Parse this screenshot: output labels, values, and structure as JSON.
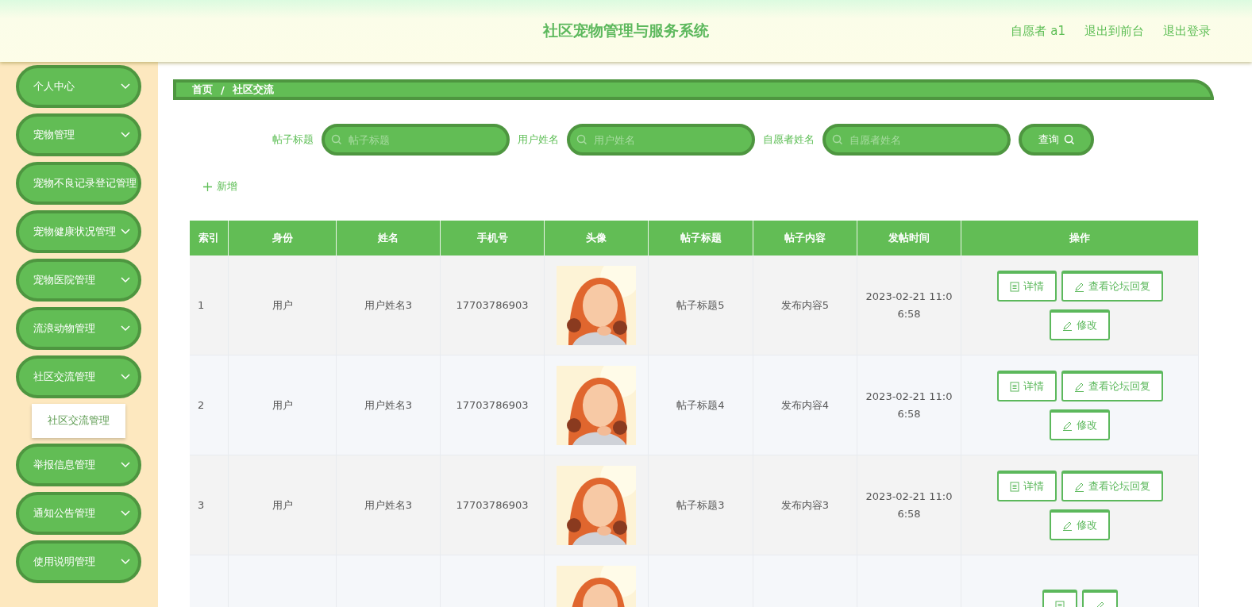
{
  "header": {
    "title": "社区宠物管理与服务系统",
    "links": [
      "自愿者 a1",
      "退出到前台",
      "退出登录"
    ]
  },
  "sidebar": {
    "items": [
      {
        "label": "个人中心",
        "has_caret": true
      },
      {
        "label": "宠物管理",
        "has_caret": true
      },
      {
        "label": "宠物不良记录登记管理",
        "has_caret": false
      },
      {
        "label": "宠物健康状况管理",
        "has_caret": true
      },
      {
        "label": "宠物医院管理",
        "has_caret": true
      },
      {
        "label": "流浪动物管理",
        "has_caret": true
      },
      {
        "label": "社区交流管理",
        "has_caret": true,
        "children": [
          {
            "label": "社区交流管理"
          }
        ]
      },
      {
        "label": "举报信息管理",
        "has_caret": true
      },
      {
        "label": "通知公告管理",
        "has_caret": true
      },
      {
        "label": "使用说明管理",
        "has_caret": true
      }
    ]
  },
  "breadcrumb": [
    "首页",
    "社区交流"
  ],
  "breadcrumb_separator": "/",
  "search": {
    "fields": [
      {
        "label": "帖子标题",
        "placeholder": "帖子标题"
      },
      {
        "label": "用户姓名",
        "placeholder": "用户姓名"
      },
      {
        "label": "自愿者姓名",
        "placeholder": "自愿者姓名"
      }
    ],
    "button": "查询"
  },
  "add_button": "新增",
  "table": {
    "columns": [
      "索引",
      "身份",
      "姓名",
      "手机号",
      "头像",
      "帖子标题",
      "帖子内容",
      "发帖时间",
      "操作"
    ],
    "rows": [
      {
        "cells": [
          "1",
          "用户",
          "用户姓名3",
          "17703786903",
          "",
          "帖子标题5",
          "发布内容5",
          "2023-02-21 11:06:58"
        ],
        "actions": [
          {
            "kind": "detail",
            "label": "详情"
          },
          {
            "kind": "edit",
            "label": "查看论坛回复"
          },
          {
            "kind": "edit",
            "label": "修改"
          }
        ]
      },
      {
        "cells": [
          "2",
          "用户",
          "用户姓名3",
          "17703786903",
          "",
          "帖子标题4",
          "发布内容4",
          "2023-02-21 11:06:58"
        ],
        "actions": [
          {
            "kind": "detail",
            "label": "详情"
          },
          {
            "kind": "edit",
            "label": "查看论坛回复"
          },
          {
            "kind": "edit",
            "label": "修改"
          }
        ]
      },
      {
        "cells": [
          "3",
          "用户",
          "用户姓名3",
          "17703786903",
          "",
          "帖子标题3",
          "发布内容3",
          "2023-02-21 11:06:58"
        ],
        "actions": [
          {
            "kind": "detail",
            "label": "详情"
          },
          {
            "kind": "edit",
            "label": "查看论坛回复"
          },
          {
            "kind": "edit",
            "label": "修改"
          }
        ]
      },
      {
        "cells": [
          "",
          "",
          "",
          "",
          "",
          "",
          "",
          ""
        ],
        "actions": [
          {
            "kind": "detail"
          },
          {
            "kind": "edit"
          }
        ]
      }
    ]
  }
}
